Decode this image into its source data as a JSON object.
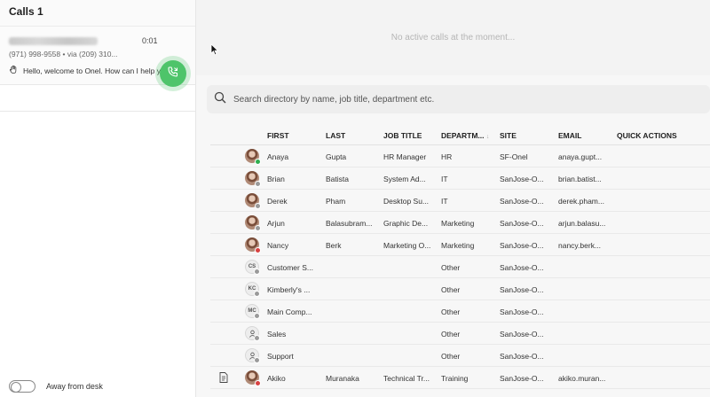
{
  "left": {
    "calls_title": "Calls 1",
    "call": {
      "timer": "0:01",
      "sub": "(971) 998-9558 • via (209) 310...",
      "greeting": "Hello, welcome to Onel. How can I help you?"
    },
    "away_label": "Away from desk"
  },
  "main": {
    "no_calls": "No active calls at the moment...",
    "search_placeholder": "Search directory by name, job title, department etc."
  },
  "table": {
    "headers": {
      "first": "FIRST",
      "last": "LAST",
      "job": "JOB TITLE",
      "dept": "DEPARTM...",
      "site": "SITE",
      "email": "EMAIL",
      "qa": "QUICK ACTIONS"
    },
    "rows": [
      {
        "first": "Anaya",
        "last": "Gupta",
        "job": "HR Manager",
        "dept": "HR",
        "site": "SF-Onel",
        "email": "anaya.gupt..."
      },
      {
        "first": "Brian",
        "last": "Batista",
        "job": "System Ad...",
        "dept": "IT",
        "site": "SanJose-O...",
        "email": "brian.batist..."
      },
      {
        "first": "Derek",
        "last": "Pham",
        "job": "Desktop Su...",
        "dept": "IT",
        "site": "SanJose-O...",
        "email": "derek.pham..."
      },
      {
        "first": "Arjun",
        "last": "Balasubram...",
        "job": "Graphic De...",
        "dept": "Marketing",
        "site": "SanJose-O...",
        "email": "arjun.balasu..."
      },
      {
        "first": "Nancy",
        "last": "Berk",
        "job": "Marketing O...",
        "dept": "Marketing",
        "site": "SanJose-O...",
        "email": "nancy.berk..."
      },
      {
        "first": "Customer S...",
        "last": "",
        "job": "",
        "dept": "Other",
        "site": "SanJose-O...",
        "email": "",
        "initials": "CS"
      },
      {
        "first": "Kimberly's ...",
        "last": "",
        "job": "",
        "dept": "Other",
        "site": "SanJose-O...",
        "email": "",
        "initials": "KC"
      },
      {
        "first": "Main Comp...",
        "last": "",
        "job": "",
        "dept": "Other",
        "site": "SanJose-O...",
        "email": "",
        "initials": "MC"
      },
      {
        "first": "Sales",
        "last": "",
        "job": "",
        "dept": "Other",
        "site": "SanJose-O...",
        "email": ""
      },
      {
        "first": "Support",
        "last": "",
        "job": "",
        "dept": "Other",
        "site": "SanJose-O...",
        "email": ""
      },
      {
        "first": "Akiko",
        "last": "Muranaka",
        "job": "Technical Tr...",
        "dept": "Training",
        "site": "SanJose-O...",
        "email": "akiko.muran..."
      }
    ]
  },
  "colors": {
    "answer_green": "#4ec46a",
    "status_online": "#2fae50",
    "status_busy": "#d84040"
  }
}
